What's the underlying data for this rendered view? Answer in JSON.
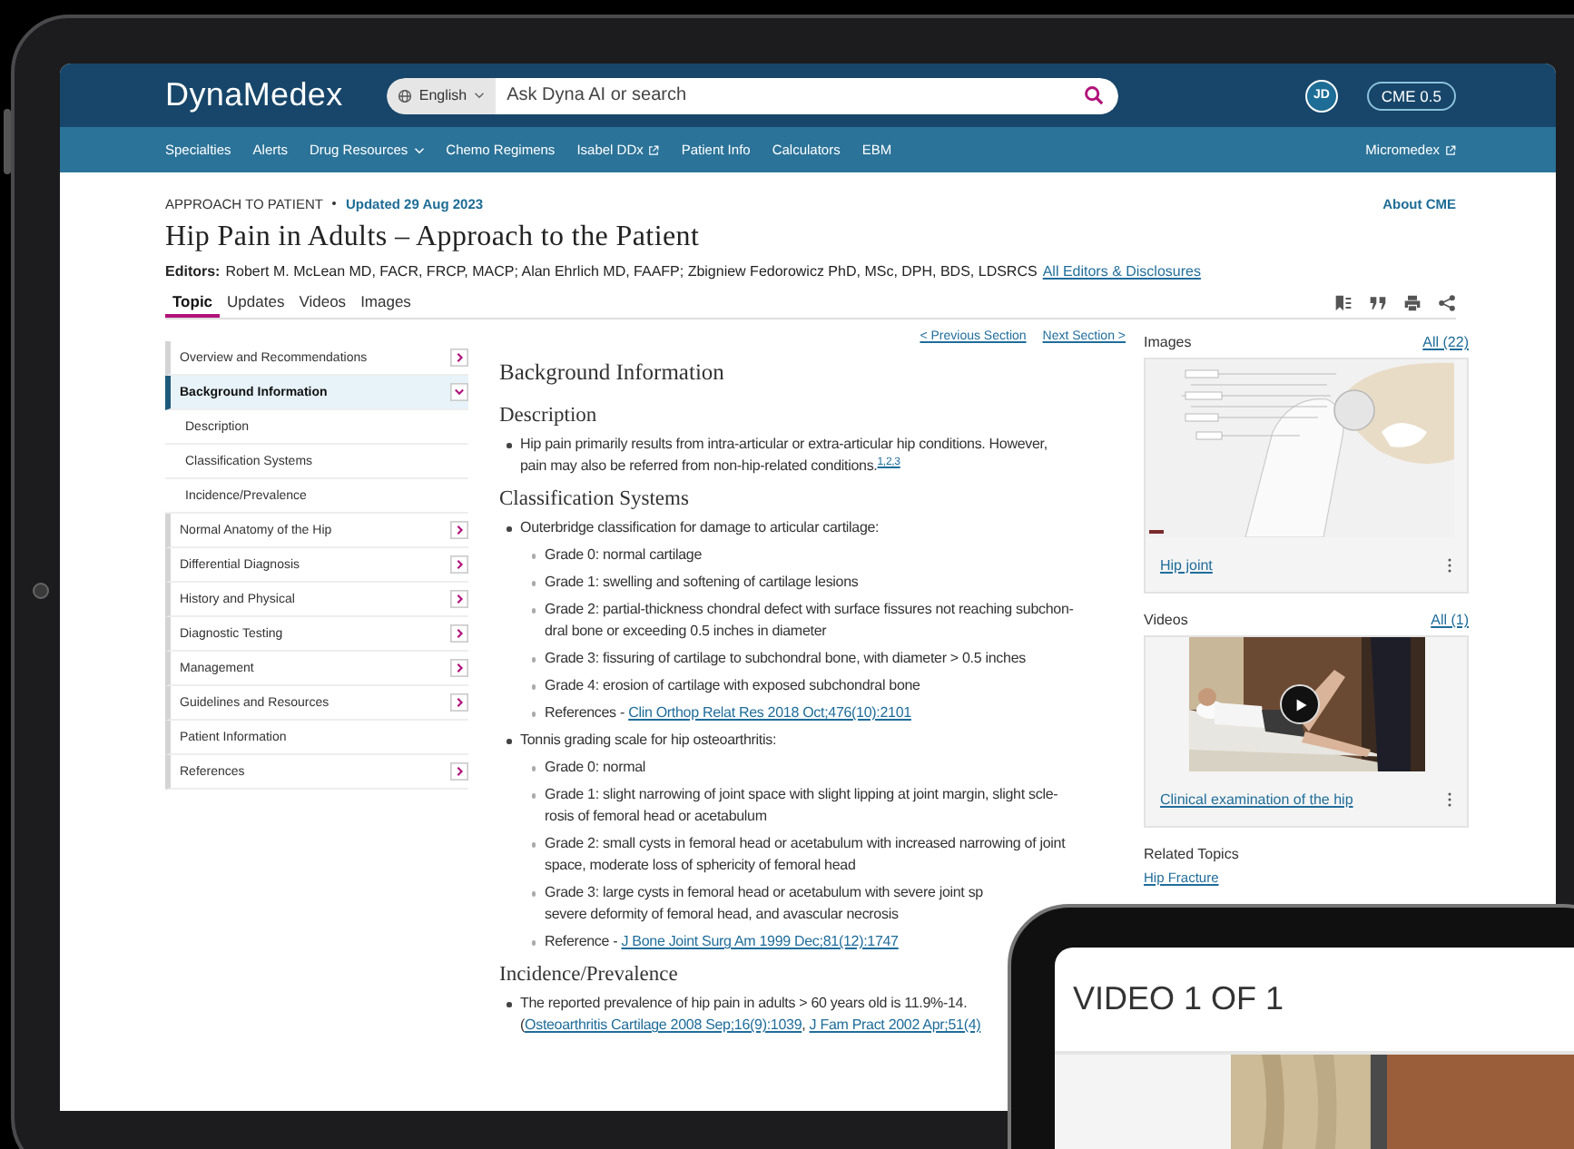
{
  "header": {
    "logo": "DynaMedex",
    "language": "English",
    "search": {
      "placeholder": "Ask Dyna AI or search"
    },
    "avatar": "JD",
    "cme": "CME 0.5"
  },
  "nav": {
    "items": [
      {
        "label": "Specialties",
        "kind": "plain"
      },
      {
        "label": "Alerts",
        "kind": "plain"
      },
      {
        "label": "Drug Resources",
        "kind": "dropdown"
      },
      {
        "label": "Chemo Regimens",
        "kind": "plain"
      },
      {
        "label": "Isabel DDx",
        "kind": "external"
      },
      {
        "label": "Patient Info",
        "kind": "plain"
      },
      {
        "label": "Calculators",
        "kind": "plain"
      },
      {
        "label": "EBM",
        "kind": "plain"
      }
    ],
    "right": {
      "label": "Micromedex",
      "kind": "external"
    }
  },
  "topic": {
    "category": "APPROACH TO PATIENT",
    "updated": "Updated 29 Aug 2023",
    "about": "About CME",
    "title": "Hip Pain in Adults – Approach to the Patient",
    "editors_label": "Editors:",
    "editors": "Robert M. McLean MD, FACR, FRCP, MACP; Alan Ehrlich MD, FAAFP; Zbigniew Fedorowicz PhD, MSc, DPH, BDS, LDSRCS",
    "editors_link": "All Editors & Disclosures"
  },
  "tabs": [
    {
      "label": "Topic",
      "selected": true
    },
    {
      "label": "Updates",
      "selected": false
    },
    {
      "label": "Videos",
      "selected": false
    },
    {
      "label": "Images",
      "selected": false
    }
  ],
  "outline": [
    {
      "label": "Overview and Recommendations",
      "selected": false,
      "expandable": true,
      "expanded": false
    },
    {
      "label": "Background Information",
      "selected": true,
      "expandable": true,
      "expanded": true,
      "children": [
        {
          "label": "Description",
          "selected": false
        },
        {
          "label": "Classification Systems",
          "selected": false
        },
        {
          "label": "Incidence/Prevalence",
          "selected": false
        }
      ]
    },
    {
      "label": "Normal Anatomy of the Hip",
      "selected": false,
      "expandable": true,
      "expanded": false
    },
    {
      "label": "Differential Diagnosis",
      "selected": false,
      "expandable": true,
      "expanded": false
    },
    {
      "label": "History and Physical",
      "selected": false,
      "expandable": true,
      "expanded": false
    },
    {
      "label": "Diagnostic Testing",
      "selected": false,
      "expandable": true,
      "expanded": false
    },
    {
      "label": "Management",
      "selected": false,
      "expandable": true,
      "expanded": false
    },
    {
      "label": "Guidelines and Resources",
      "selected": false,
      "expandable": true,
      "expanded": false
    },
    {
      "label": "Patient Information",
      "selected": false,
      "expandable": false
    },
    {
      "label": "References",
      "selected": false,
      "expandable": true,
      "expanded": false
    }
  ],
  "article": {
    "prev": "< Previous Section",
    "next": "Next Section >",
    "title": "Background Information",
    "sections": [
      {
        "heading": "Description",
        "items": [
          {
            "lines": [
              [
                {
                  "kind": "text",
                  "text": "Hip pain primarily results from intra-articular or extra-articular hip conditions. However,"
                }
              ],
              [
                {
                  "kind": "text",
                  "text": "pain may also be referred from non-hip-related conditions."
                },
                {
                  "kind": "sup_link",
                  "text": "1,2,3"
                }
              ]
            ]
          }
        ]
      },
      {
        "heading": "Classification Systems",
        "items": [
          {
            "lines": [
              [
                {
                  "kind": "text",
                  "text": "Outerbridge classification for damage to articular cartilage:"
                }
              ]
            ],
            "children": [
              {
                "lines": [
                  [
                    {
                      "kind": "text",
                      "text": "Grade 0: normal cartilage"
                    }
                  ]
                ]
              },
              {
                "lines": [
                  [
                    {
                      "kind": "text",
                      "text": "Grade 1: swelling and softening of cartilage lesions"
                    }
                  ]
                ]
              },
              {
                "lines": [
                  [
                    {
                      "kind": "text",
                      "text": "Grade 2: partial-thickness chondral defect with surface fissures not reaching subchon-"
                    }
                  ],
                  [
                    {
                      "kind": "text",
                      "text": "dral bone or exceeding 0.5 inches in diameter"
                    }
                  ]
                ]
              },
              {
                "lines": [
                  [
                    {
                      "kind": "text",
                      "text": "Grade 3: fissuring of cartilage to subchondral bone, with diameter > 0.5 inches"
                    }
                  ]
                ]
              },
              {
                "lines": [
                  [
                    {
                      "kind": "text",
                      "text": "Grade 4: erosion of cartilage with exposed subchondral bone"
                    }
                  ]
                ]
              },
              {
                "lines": [
                  [
                    {
                      "kind": "text",
                      "text": "References - "
                    },
                    {
                      "kind": "link",
                      "text": "Clin Orthop Relat Res 2018 Oct;476(10):2101"
                    }
                  ]
                ]
              }
            ]
          },
          {
            "lines": [
              [
                {
                  "kind": "text",
                  "text": "Tonnis grading scale for hip osteoarthritis:"
                }
              ]
            ],
            "children": [
              {
                "lines": [
                  [
                    {
                      "kind": "text",
                      "text": "Grade 0: normal"
                    }
                  ]
                ]
              },
              {
                "lines": [
                  [
                    {
                      "kind": "text",
                      "text": "Grade 1: slight narrowing of joint space with slight lipping at joint margin, slight scle-"
                    }
                  ],
                  [
                    {
                      "kind": "text",
                      "text": "rosis of femoral head or acetabulum"
                    }
                  ]
                ]
              },
              {
                "lines": [
                  [
                    {
                      "kind": "text",
                      "text": "Grade 2: small cysts in femoral head or acetabulum with increased narrowing of joint"
                    }
                  ],
                  [
                    {
                      "kind": "text",
                      "text": "space, moderate loss of sphericity of femoral head"
                    }
                  ]
                ]
              },
              {
                "lines": [
                  [
                    {
                      "kind": "text",
                      "text": "Grade 3: large cysts in femoral head or acetabulum with severe joint sp"
                    }
                  ],
                  [
                    {
                      "kind": "text",
                      "text": "severe deformity of femoral head, and avascular necrosis"
                    }
                  ]
                ]
              },
              {
                "lines": [
                  [
                    {
                      "kind": "text",
                      "text": "Reference - "
                    },
                    {
                      "kind": "link",
                      "text": "J Bone Joint Surg Am 1999 Dec;81(12):1747"
                    }
                  ]
                ]
              }
            ]
          }
        ]
      },
      {
        "heading": "Incidence/Prevalence",
        "items": [
          {
            "lines": [
              [
                {
                  "kind": "text",
                  "text": "The reported prevalence of hip pain in adults > 60 years old is 11.9%-14."
                }
              ],
              [
                {
                  "kind": "text",
                  "text": "("
                },
                {
                  "kind": "link",
                  "text": "Osteoarthritis Cartilage 2008 Sep;16(9):1039"
                },
                {
                  "kind": "text",
                  "text": ", "
                },
                {
                  "kind": "link",
                  "text": "J Fam Pract 2002 Apr;51(4)"
                }
              ]
            ]
          }
        ]
      }
    ]
  },
  "media": {
    "images": {
      "label": "Images",
      "all": "All (22)",
      "caption": "Hip joint"
    },
    "videos": {
      "label": "Videos",
      "all": "All (1)",
      "caption": "Clinical examination of the hip"
    },
    "related": {
      "label": "Related Topics",
      "items": [
        "Hip Fracture"
      ]
    }
  },
  "player": {
    "title": "VIDEO 1 OF 1"
  }
}
